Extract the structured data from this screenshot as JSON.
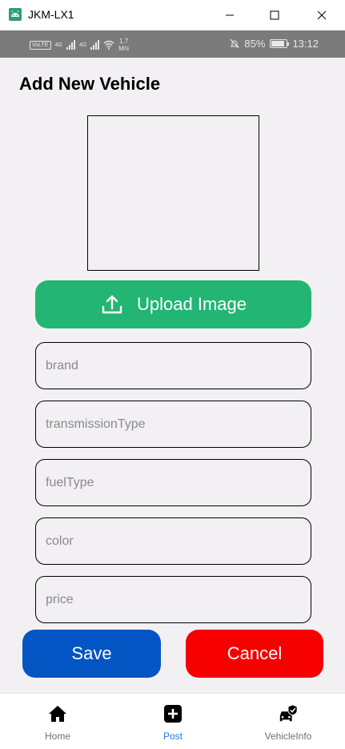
{
  "window": {
    "title": "JKM-LX1"
  },
  "status_bar": {
    "left_text": "VoLTE",
    "signal1": "4G",
    "signal2": "4G",
    "net_speed_value": "1.7",
    "net_speed_unit": "M/s",
    "battery_percent": "85%",
    "battery_level": 0.85,
    "time": "13:12"
  },
  "page": {
    "title": "Add New Vehicle"
  },
  "upload_button": {
    "label": "Upload Image"
  },
  "fields": {
    "brand": "brand",
    "transmission": "transmissionType",
    "fuel": "fuelType",
    "color": "color",
    "price": "price"
  },
  "actions": {
    "save": "Save",
    "cancel": "Cancel"
  },
  "nav": {
    "items": [
      {
        "label": "Home",
        "icon": "home-icon",
        "active": false
      },
      {
        "label": "Post",
        "icon": "add-box-icon",
        "active": true
      },
      {
        "label": "VehicleInfo",
        "icon": "car-check-icon",
        "active": false
      }
    ]
  },
  "colors": {
    "upload": "#23b573",
    "save": "#0355c4",
    "cancel": "#f60000",
    "nav_active": "#1f7ad6"
  }
}
